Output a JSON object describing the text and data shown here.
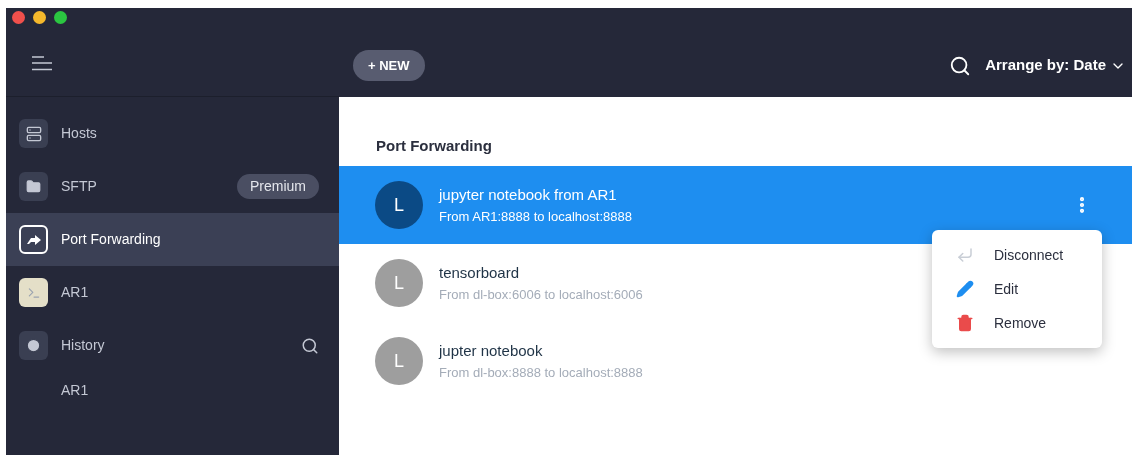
{
  "sidebar": {
    "items": [
      {
        "kind": "hosts",
        "label": "Hosts",
        "selected": false
      },
      {
        "kind": "sftp",
        "label": "SFTP",
        "badge": "Premium",
        "selected": false
      },
      {
        "kind": "port-forwarding",
        "label": "Port Forwarding",
        "selected": true
      },
      {
        "kind": "terminal",
        "label": "AR1",
        "selected": false
      },
      {
        "kind": "history",
        "label": "History",
        "selected": false
      }
    ],
    "history": [
      "AR1"
    ]
  },
  "toolbar": {
    "new_button": "+ NEW",
    "arrange": "Arrange by: Date"
  },
  "section_title": "Port Forwarding",
  "rules": [
    {
      "avatar": "L",
      "name": "jupyter notebook from AR1",
      "detail": "From AR1:8888 to localhost:8888",
      "selected": true
    },
    {
      "avatar": "L",
      "name": "tensorboard",
      "detail": "From dl-box:6006 to localhost:6006",
      "selected": false
    },
    {
      "avatar": "L",
      "name": "jupter notebook",
      "detail": "From dl-box:8888 to localhost:8888",
      "selected": false
    }
  ],
  "context_menu": [
    {
      "kind": "disconnect",
      "label": "Disconnect"
    },
    {
      "kind": "edit",
      "label": "Edit"
    },
    {
      "kind": "remove",
      "label": "Remove"
    }
  ]
}
